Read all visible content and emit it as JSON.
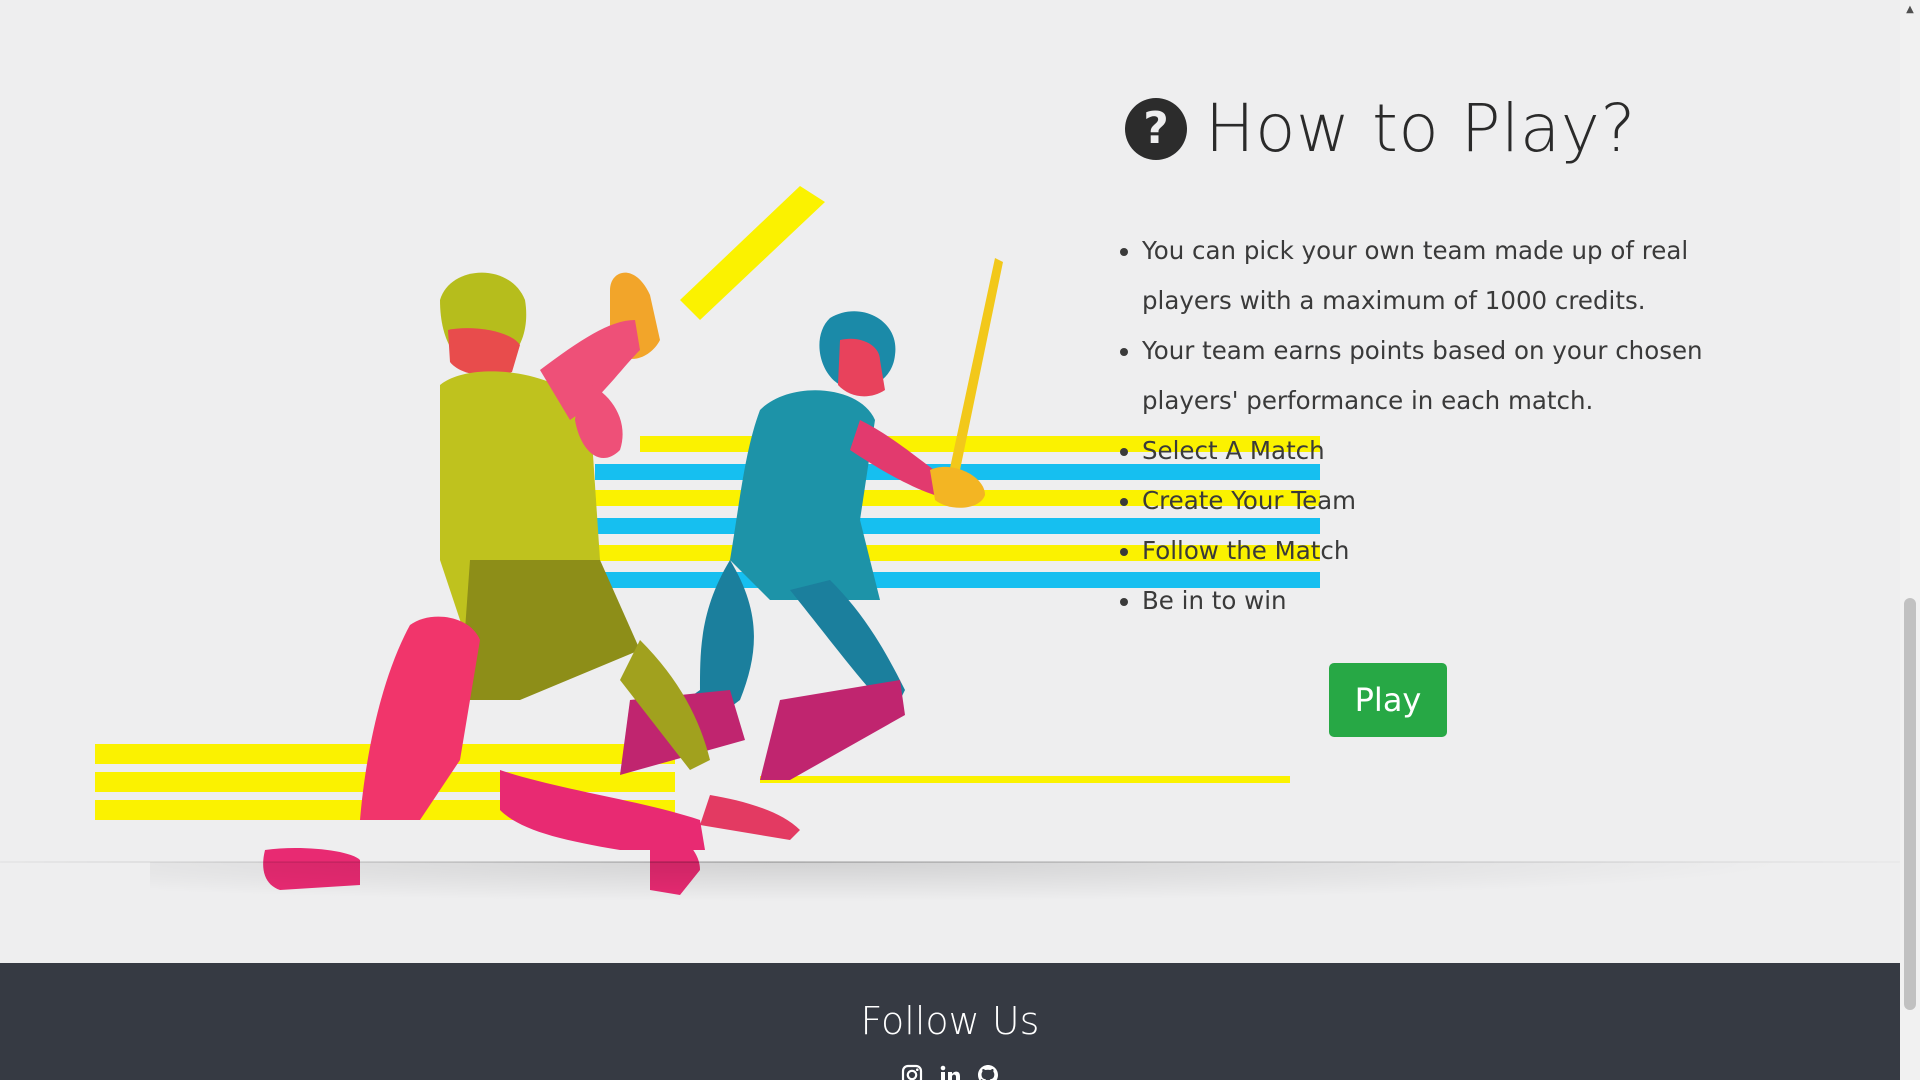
{
  "how_to_play": {
    "title": "How to Play?",
    "icon": "question-circle-icon",
    "items": [
      "You can pick your own team made up of real players with a maximum of 1000 credits.",
      "Your team earns points based on your chosen players' performance in each match.",
      "Select A Match",
      "Create Your Team",
      "Follow the Match",
      "Be in to win"
    ],
    "play_label": "Play"
  },
  "footer": {
    "title": "Follow Us",
    "social_icons": [
      "instagram-icon",
      "linkedin-icon",
      "github-icon"
    ]
  },
  "colors": {
    "background": "#eeeeef",
    "play_button": "#27a845",
    "footer": "#363a43",
    "stripe_yellow": "#fbf200",
    "stripe_blue": "#16bff0"
  }
}
